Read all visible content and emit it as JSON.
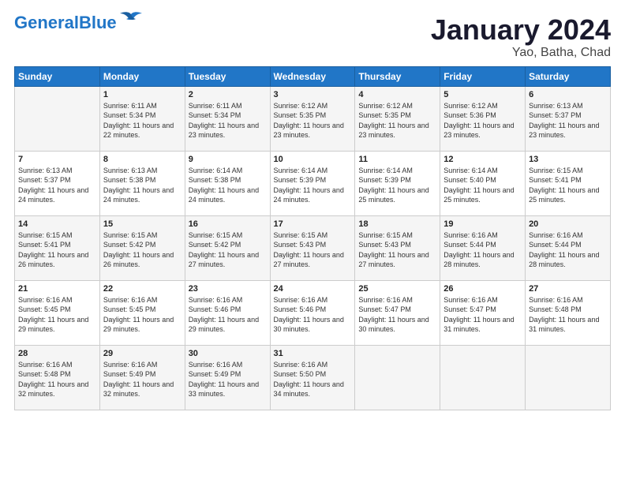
{
  "logo": {
    "line1": "General",
    "line2": "Blue"
  },
  "title": "January 2024",
  "location": "Yao, Batha, Chad",
  "days_header": [
    "Sunday",
    "Monday",
    "Tuesday",
    "Wednesday",
    "Thursday",
    "Friday",
    "Saturday"
  ],
  "weeks": [
    [
      {
        "day": "",
        "sunrise": "",
        "sunset": "",
        "daylight": ""
      },
      {
        "day": "1",
        "sunrise": "Sunrise: 6:11 AM",
        "sunset": "Sunset: 5:34 PM",
        "daylight": "Daylight: 11 hours and 22 minutes."
      },
      {
        "day": "2",
        "sunrise": "Sunrise: 6:11 AM",
        "sunset": "Sunset: 5:34 PM",
        "daylight": "Daylight: 11 hours and 23 minutes."
      },
      {
        "day": "3",
        "sunrise": "Sunrise: 6:12 AM",
        "sunset": "Sunset: 5:35 PM",
        "daylight": "Daylight: 11 hours and 23 minutes."
      },
      {
        "day": "4",
        "sunrise": "Sunrise: 6:12 AM",
        "sunset": "Sunset: 5:35 PM",
        "daylight": "Daylight: 11 hours and 23 minutes."
      },
      {
        "day": "5",
        "sunrise": "Sunrise: 6:12 AM",
        "sunset": "Sunset: 5:36 PM",
        "daylight": "Daylight: 11 hours and 23 minutes."
      },
      {
        "day": "6",
        "sunrise": "Sunrise: 6:13 AM",
        "sunset": "Sunset: 5:37 PM",
        "daylight": "Daylight: 11 hours and 23 minutes."
      }
    ],
    [
      {
        "day": "7",
        "sunrise": "Sunrise: 6:13 AM",
        "sunset": "Sunset: 5:37 PM",
        "daylight": "Daylight: 11 hours and 24 minutes."
      },
      {
        "day": "8",
        "sunrise": "Sunrise: 6:13 AM",
        "sunset": "Sunset: 5:38 PM",
        "daylight": "Daylight: 11 hours and 24 minutes."
      },
      {
        "day": "9",
        "sunrise": "Sunrise: 6:14 AM",
        "sunset": "Sunset: 5:38 PM",
        "daylight": "Daylight: 11 hours and 24 minutes."
      },
      {
        "day": "10",
        "sunrise": "Sunrise: 6:14 AM",
        "sunset": "Sunset: 5:39 PM",
        "daylight": "Daylight: 11 hours and 24 minutes."
      },
      {
        "day": "11",
        "sunrise": "Sunrise: 6:14 AM",
        "sunset": "Sunset: 5:39 PM",
        "daylight": "Daylight: 11 hours and 25 minutes."
      },
      {
        "day": "12",
        "sunrise": "Sunrise: 6:14 AM",
        "sunset": "Sunset: 5:40 PM",
        "daylight": "Daylight: 11 hours and 25 minutes."
      },
      {
        "day": "13",
        "sunrise": "Sunrise: 6:15 AM",
        "sunset": "Sunset: 5:41 PM",
        "daylight": "Daylight: 11 hours and 25 minutes."
      }
    ],
    [
      {
        "day": "14",
        "sunrise": "Sunrise: 6:15 AM",
        "sunset": "Sunset: 5:41 PM",
        "daylight": "Daylight: 11 hours and 26 minutes."
      },
      {
        "day": "15",
        "sunrise": "Sunrise: 6:15 AM",
        "sunset": "Sunset: 5:42 PM",
        "daylight": "Daylight: 11 hours and 26 minutes."
      },
      {
        "day": "16",
        "sunrise": "Sunrise: 6:15 AM",
        "sunset": "Sunset: 5:42 PM",
        "daylight": "Daylight: 11 hours and 27 minutes."
      },
      {
        "day": "17",
        "sunrise": "Sunrise: 6:15 AM",
        "sunset": "Sunset: 5:43 PM",
        "daylight": "Daylight: 11 hours and 27 minutes."
      },
      {
        "day": "18",
        "sunrise": "Sunrise: 6:15 AM",
        "sunset": "Sunset: 5:43 PM",
        "daylight": "Daylight: 11 hours and 27 minutes."
      },
      {
        "day": "19",
        "sunrise": "Sunrise: 6:16 AM",
        "sunset": "Sunset: 5:44 PM",
        "daylight": "Daylight: 11 hours and 28 minutes."
      },
      {
        "day": "20",
        "sunrise": "Sunrise: 6:16 AM",
        "sunset": "Sunset: 5:44 PM",
        "daylight": "Daylight: 11 hours and 28 minutes."
      }
    ],
    [
      {
        "day": "21",
        "sunrise": "Sunrise: 6:16 AM",
        "sunset": "Sunset: 5:45 PM",
        "daylight": "Daylight: 11 hours and 29 minutes."
      },
      {
        "day": "22",
        "sunrise": "Sunrise: 6:16 AM",
        "sunset": "Sunset: 5:45 PM",
        "daylight": "Daylight: 11 hours and 29 minutes."
      },
      {
        "day": "23",
        "sunrise": "Sunrise: 6:16 AM",
        "sunset": "Sunset: 5:46 PM",
        "daylight": "Daylight: 11 hours and 29 minutes."
      },
      {
        "day": "24",
        "sunrise": "Sunrise: 6:16 AM",
        "sunset": "Sunset: 5:46 PM",
        "daylight": "Daylight: 11 hours and 30 minutes."
      },
      {
        "day": "25",
        "sunrise": "Sunrise: 6:16 AM",
        "sunset": "Sunset: 5:47 PM",
        "daylight": "Daylight: 11 hours and 30 minutes."
      },
      {
        "day": "26",
        "sunrise": "Sunrise: 6:16 AM",
        "sunset": "Sunset: 5:47 PM",
        "daylight": "Daylight: 11 hours and 31 minutes."
      },
      {
        "day": "27",
        "sunrise": "Sunrise: 6:16 AM",
        "sunset": "Sunset: 5:48 PM",
        "daylight": "Daylight: 11 hours and 31 minutes."
      }
    ],
    [
      {
        "day": "28",
        "sunrise": "Sunrise: 6:16 AM",
        "sunset": "Sunset: 5:48 PM",
        "daylight": "Daylight: 11 hours and 32 minutes."
      },
      {
        "day": "29",
        "sunrise": "Sunrise: 6:16 AM",
        "sunset": "Sunset: 5:49 PM",
        "daylight": "Daylight: 11 hours and 32 minutes."
      },
      {
        "day": "30",
        "sunrise": "Sunrise: 6:16 AM",
        "sunset": "Sunset: 5:49 PM",
        "daylight": "Daylight: 11 hours and 33 minutes."
      },
      {
        "day": "31",
        "sunrise": "Sunrise: 6:16 AM",
        "sunset": "Sunset: 5:50 PM",
        "daylight": "Daylight: 11 hours and 34 minutes."
      },
      {
        "day": "",
        "sunrise": "",
        "sunset": "",
        "daylight": ""
      },
      {
        "day": "",
        "sunrise": "",
        "sunset": "",
        "daylight": ""
      },
      {
        "day": "",
        "sunrise": "",
        "sunset": "",
        "daylight": ""
      }
    ]
  ]
}
